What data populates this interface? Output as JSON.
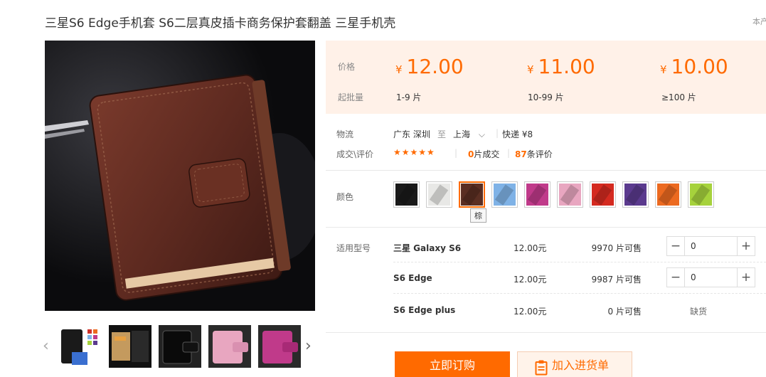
{
  "product": {
    "title": "三星S6 Edge手机套 S6二层真皮插卡商务保护套翻盖 三星手机壳",
    "corner_text": "本产"
  },
  "price_tiers": {
    "price_label": "价格",
    "moq_label": "起批量",
    "currency": "¥",
    "tiers": [
      {
        "price": "12.00",
        "qty": "1-9 片"
      },
      {
        "price": "11.00",
        "qty": "10-99 片"
      },
      {
        "price": "10.00",
        "qty": "≥100 片"
      }
    ]
  },
  "logistics": {
    "label": "物流",
    "from": "广东 深圳",
    "to_word": "至",
    "to": "上海",
    "shipping": "快递 ¥8"
  },
  "deals": {
    "label": "成交\\评价",
    "stars": "★★★★★",
    "deals_count": "0",
    "deals_suffix": "片成交",
    "reviews_count": "87",
    "reviews_suffix": "条评价"
  },
  "color": {
    "label": "颜色",
    "tooltip": "棕",
    "swatches": [
      {
        "hex": "#1a1a1a"
      },
      {
        "hex": "#e8e8e6"
      },
      {
        "hex": "#5a2e22"
      },
      {
        "hex": "#7fb2e6"
      },
      {
        "hex": "#c03a8a"
      },
      {
        "hex": "#e8a6c0"
      },
      {
        "hex": "#d42a20"
      },
      {
        "hex": "#5b3a8e"
      },
      {
        "hex": "#ec6a20"
      },
      {
        "hex": "#a6d23c"
      }
    ]
  },
  "models": {
    "label": "适用型号",
    "rows": [
      {
        "name": "三星 Galaxy S6",
        "price": "12.00元",
        "stock": "9970 片可售",
        "qty": "0"
      },
      {
        "name": "S6 Edge",
        "price": "12.00元",
        "stock": "9987 片可售",
        "qty": "0"
      },
      {
        "name": "S6 Edge plus",
        "price": "12.00元",
        "stock": "0 片可售",
        "status": "缺货"
      }
    ]
  },
  "actions": {
    "buy_now": "立即订购",
    "add_to_cart": "加入进货单"
  },
  "colors": {
    "accent": "#ff6a00",
    "price_bg": "#fff1e8"
  }
}
